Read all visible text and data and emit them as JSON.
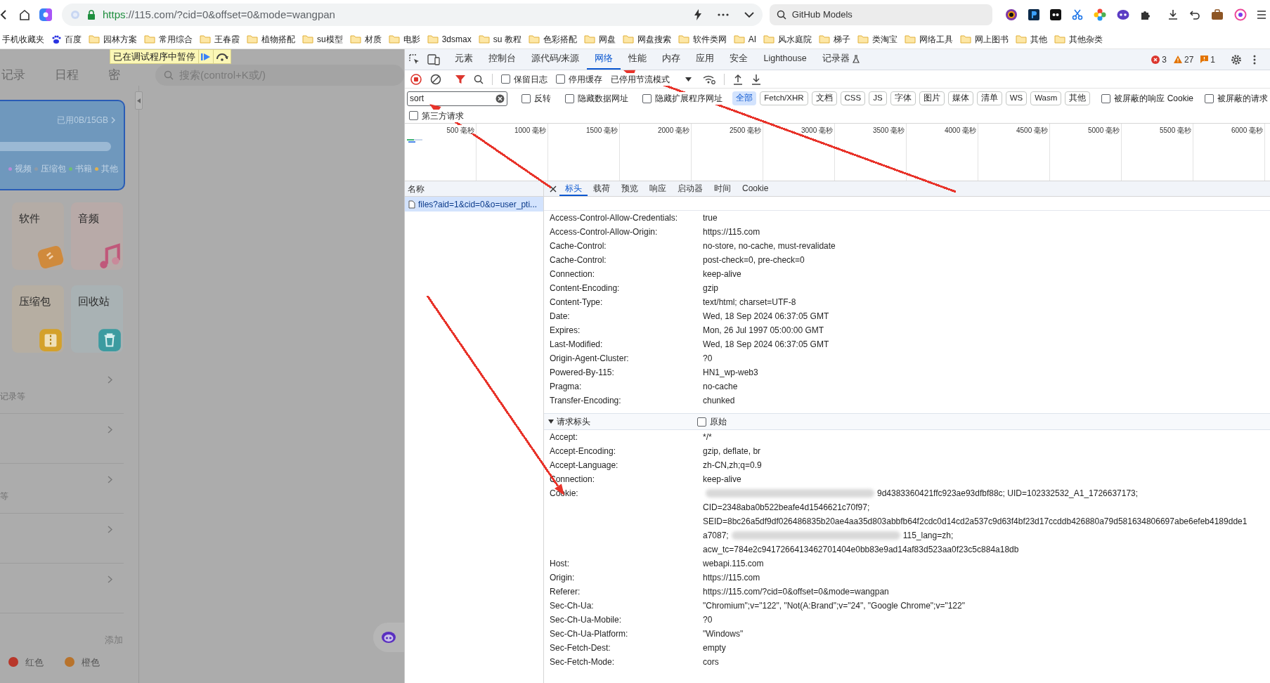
{
  "browser": {
    "url_scheme": "https",
    "url_rest": "://115.com/?cid=0&offset=0&mode=wangpan",
    "search_value": "GitHub Models"
  },
  "bookmarks": [
    {
      "label": "手机收藏夹",
      "kind": "plain"
    },
    {
      "label": "百度",
      "kind": "paw"
    },
    {
      "label": "园林方案",
      "kind": "folder"
    },
    {
      "label": "常用综合",
      "kind": "folder"
    },
    {
      "label": "王春霞",
      "kind": "folder"
    },
    {
      "label": "植物搭配",
      "kind": "folder"
    },
    {
      "label": "su模型",
      "kind": "folder"
    },
    {
      "label": "材质",
      "kind": "folder"
    },
    {
      "label": "电影",
      "kind": "folder"
    },
    {
      "label": "3dsmax",
      "kind": "folder"
    },
    {
      "label": "su 教程",
      "kind": "folder"
    },
    {
      "label": "色彩搭配",
      "kind": "folder"
    },
    {
      "label": "网盘",
      "kind": "folder"
    },
    {
      "label": "网盘搜索",
      "kind": "folder"
    },
    {
      "label": "软件类网",
      "kind": "folder"
    },
    {
      "label": "AI",
      "kind": "folder"
    },
    {
      "label": "风水庭院",
      "kind": "folder"
    },
    {
      "label": "梯子",
      "kind": "folder"
    },
    {
      "label": "类淘宝",
      "kind": "folder"
    },
    {
      "label": "网络工具",
      "kind": "folder"
    },
    {
      "label": "网上图书",
      "kind": "folder"
    },
    {
      "label": "其他",
      "kind": "folder"
    },
    {
      "label": "其他杂类",
      "kind": "folder"
    }
  ],
  "app": {
    "tabs": [
      "记录",
      "日程",
      "密"
    ],
    "search_placeholder": "搜索(control+K或/)",
    "paused_banner": "已在调试程序中暂停",
    "storage": {
      "usage": "已用0B/15GB",
      "level": 0,
      "legend": [
        {
          "label": "视频",
          "color": "#b98ad6"
        },
        {
          "label": "压缩包",
          "color": "#8f9aa6"
        },
        {
          "label": "书籍",
          "color": "#6fbf73"
        },
        {
          "label": "其他",
          "color": "#e0b050"
        }
      ]
    },
    "categories": [
      {
        "label": "软件",
        "kind": "software"
      },
      {
        "label": "音频",
        "kind": "audio"
      },
      {
        "label": "压缩包",
        "kind": "archive"
      },
      {
        "label": "回收站",
        "kind": "trash"
      }
    ],
    "menu_rows": [
      {
        "kind": "caption",
        "caption": "记录等"
      },
      {
        "kind": "plain"
      },
      {
        "kind": "caption",
        "caption": "等"
      },
      {
        "kind": "plain"
      },
      {
        "kind": "plain"
      }
    ],
    "add_label": "添加",
    "tags": [
      {
        "label": "红色",
        "color": "#b8372a"
      },
      {
        "label": "橙色",
        "color": "#b8732c"
      }
    ]
  },
  "devtools": {
    "tabs": [
      {
        "label": "元素",
        "selected": false
      },
      {
        "label": "控制台",
        "selected": false
      },
      {
        "label": "源代码/来源",
        "selected": false
      },
      {
        "label": "网络",
        "selected": true
      },
      {
        "label": "性能",
        "selected": false
      },
      {
        "label": "内存",
        "selected": false
      },
      {
        "label": "应用",
        "selected": false
      },
      {
        "label": "安全",
        "selected": false
      },
      {
        "label": "Lighthouse",
        "selected": false
      },
      {
        "label": "记录器",
        "selected": false,
        "kind": "experimental"
      }
    ],
    "counts": {
      "errors": "3",
      "warnings": "27",
      "info": "1"
    },
    "recording": true,
    "preserve_log": {
      "label": "保留日志",
      "checked": false
    },
    "disable_cache": {
      "label": "停用缓存",
      "checked": false
    },
    "throttling": "已停用节流模式",
    "filter_value": "sort",
    "filter_options": [
      {
        "label": "反转",
        "checked": false
      },
      {
        "label": "隐藏数据网址",
        "checked": false
      },
      {
        "label": "隐藏扩展程序网址",
        "checked": false
      }
    ],
    "type_filters": [
      {
        "label": "全部",
        "selected": true
      },
      {
        "label": "Fetch/XHR",
        "selected": false
      },
      {
        "label": "文档",
        "selected": false
      },
      {
        "label": "CSS",
        "selected": false
      },
      {
        "label": "JS",
        "selected": false
      },
      {
        "label": "字体",
        "selected": false
      },
      {
        "label": "图片",
        "selected": false
      },
      {
        "label": "媒体",
        "selected": false
      },
      {
        "label": "清单",
        "selected": false
      },
      {
        "label": "WS",
        "selected": false
      },
      {
        "label": "Wasm",
        "selected": false
      },
      {
        "label": "其他",
        "selected": false
      }
    ],
    "blocked_options": [
      {
        "label": "被屏蔽的响应 Cookie",
        "checked": false
      },
      {
        "label": "被屏蔽的请求",
        "checked": false
      }
    ],
    "third_party": {
      "label": "第三方请求",
      "checked": false
    },
    "timeline_ticks": [
      "500 毫秒",
      "1000 毫秒",
      "1500 毫秒",
      "2000 毫秒",
      "2500 毫秒",
      "3000 毫秒",
      "3500 毫秒",
      "4000 毫秒",
      "4500 毫秒",
      "5000 毫秒",
      "5500 毫秒",
      "6000 毫秒"
    ],
    "requests_header": "名称",
    "requests": [
      {
        "name": "files?aid=1&cid=0&o=user_pti...",
        "selected": true
      }
    ],
    "detail_tabs": [
      {
        "label": "标头",
        "selected": true
      },
      {
        "label": "载荷",
        "selected": false
      },
      {
        "label": "预览",
        "selected": false
      },
      {
        "label": "响应",
        "selected": false
      },
      {
        "label": "启动器",
        "selected": false
      },
      {
        "label": "时间",
        "selected": false
      },
      {
        "label": "Cookie",
        "selected": false
      }
    ],
    "response_headers": [
      {
        "name": "Access-Control-Allow-Credentials:",
        "value": "true"
      },
      {
        "name": "Access-Control-Allow-Origin:",
        "value": "https://115.com"
      },
      {
        "name": "Cache-Control:",
        "value": "no-store, no-cache, must-revalidate"
      },
      {
        "name": "Cache-Control:",
        "value": "post-check=0, pre-check=0"
      },
      {
        "name": "Connection:",
        "value": "keep-alive"
      },
      {
        "name": "Content-Encoding:",
        "value": "gzip"
      },
      {
        "name": "Content-Type:",
        "value": "text/html; charset=UTF-8"
      },
      {
        "name": "Date:",
        "value": "Wed, 18 Sep 2024 06:37:05 GMT"
      },
      {
        "name": "Expires:",
        "value": "Mon, 26 Jul 1997 05:00:00 GMT"
      },
      {
        "name": "Last-Modified:",
        "value": "Wed, 18 Sep 2024 06:37:05 GMT"
      },
      {
        "name": "Origin-Agent-Cluster:",
        "value": "?0"
      },
      {
        "name": "Powered-By-115:",
        "value": "HN1_wp-web3"
      },
      {
        "name": "Pragma:",
        "value": "no-cache"
      },
      {
        "name": "Transfer-Encoding:",
        "value": "chunked"
      }
    ],
    "request_section": {
      "title": "请求标头",
      "expanded": true,
      "raw": {
        "label": "原始",
        "checked": false
      }
    },
    "request_headers": [
      {
        "name": "Accept:",
        "value": "*/*"
      },
      {
        "name": "Accept-Encoding:",
        "value": "gzip, deflate, br"
      },
      {
        "name": "Accept-Language:",
        "value": "zh-CN,zh;q=0.9"
      },
      {
        "name": "Connection:",
        "value": "keep-alive"
      },
      {
        "name": "Cookie:",
        "value_lines": [
          [
            {
              "kind": "blur"
            },
            {
              "kind": "text",
              "text": "9d4383360421ffc923ae93dfbf88c; UID=102332532_A1_1726637173;"
            }
          ],
          [
            {
              "kind": "text",
              "text": "CID=2348aba0b522beafe4d1546621c70f97;"
            }
          ],
          [
            {
              "kind": "text",
              "text": "SEID=8bc26a5df9df026486835b20ae4aa35d803abbfb64f2cdc0d14cd2a537c9d63f4bf23d17ccddb426880a79d581634806697abe6efeb4189dde1"
            }
          ],
          [
            {
              "kind": "text",
              "text": "a7087;"
            },
            {
              "kind": "blur"
            },
            {
              "kind": "text",
              "text": "115_lang=zh;"
            }
          ],
          [
            {
              "kind": "text",
              "text": "acw_tc=784e2c9417266413462701404e0bb83e9ad14af83d523aa0f23c5c884a18db"
            }
          ]
        ]
      },
      {
        "name": "Host:",
        "value": "webapi.115.com"
      },
      {
        "name": "Origin:",
        "value": "https://115.com"
      },
      {
        "name": "Referer:",
        "value": "https://115.com/?cid=0&offset=0&mode=wangpan"
      },
      {
        "name": "Sec-Ch-Ua:",
        "value": "\"Chromium\";v=\"122\", \"Not(A:Brand\";v=\"24\", \"Google Chrome\";v=\"122\""
      },
      {
        "name": "Sec-Ch-Ua-Mobile:",
        "value": "?0"
      },
      {
        "name": "Sec-Ch-Ua-Platform:",
        "value": "\"Windows\""
      },
      {
        "name": "Sec-Fetch-Dest:",
        "value": "empty"
      },
      {
        "name": "Sec-Fetch-Mode:",
        "value": "cors"
      }
    ]
  },
  "annotation_arrows": [
    {
      "color": "#e8332a"
    },
    {
      "color": "#e8332a"
    },
    {
      "color": "#e8332a"
    }
  ]
}
